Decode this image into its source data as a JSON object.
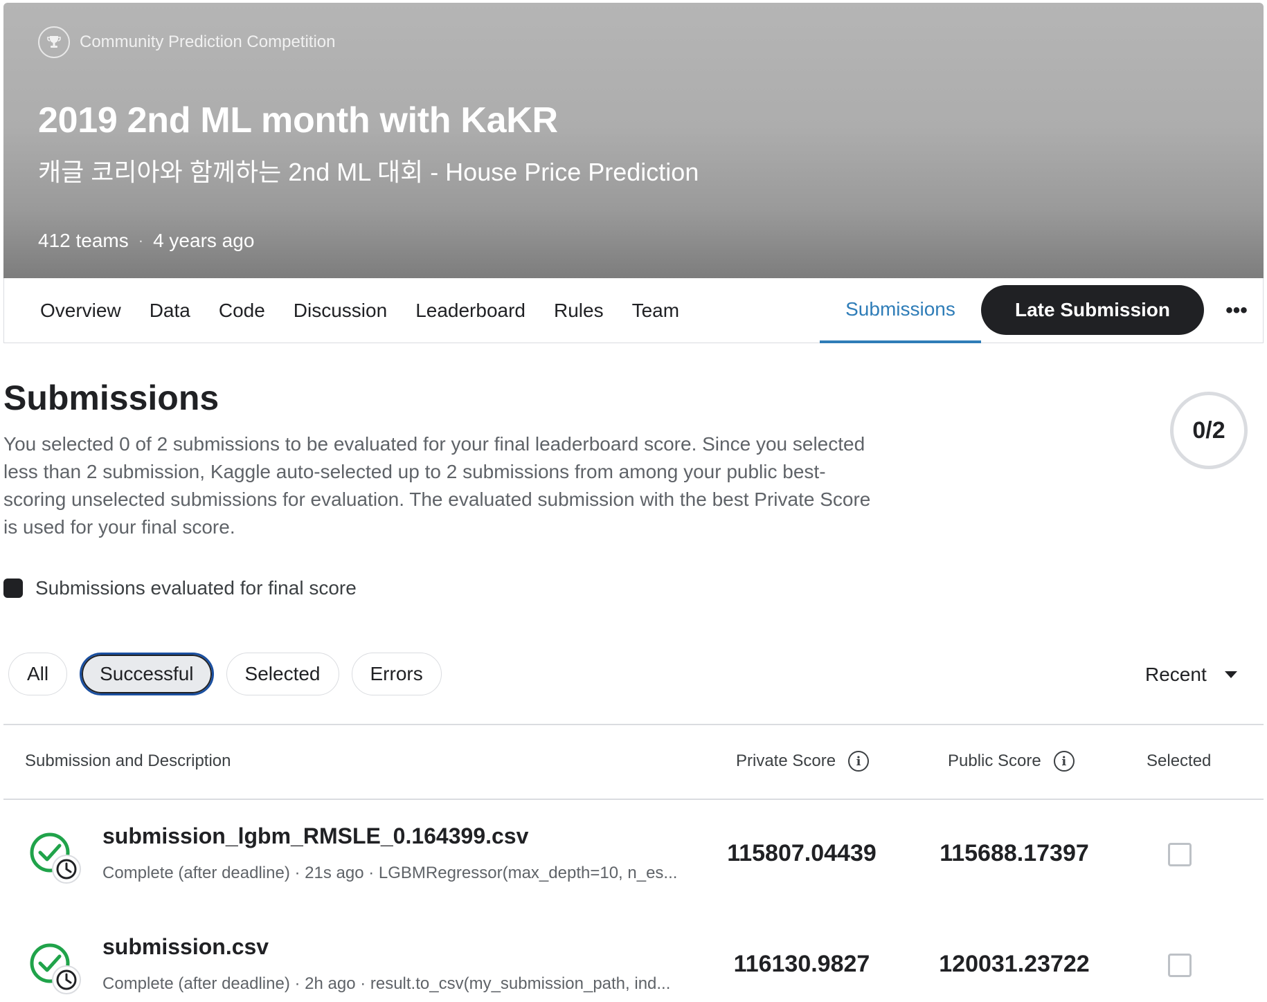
{
  "header": {
    "badge_label": "Community Prediction Competition",
    "badge_icon": "trophy-icon",
    "title": "2019 2nd ML month with KaKR",
    "subtitle": "캐글 코리아와 함께하는 2nd ML 대회 - House Price Prediction",
    "teams": "412 teams",
    "separator": "·",
    "age": "4 years ago"
  },
  "nav": {
    "tabs": [
      "Overview",
      "Data",
      "Code",
      "Discussion",
      "Leaderboard",
      "Rules",
      "Team"
    ],
    "active_tab": "Submissions",
    "late_submission": "Late Submission",
    "more": "•••"
  },
  "submissions": {
    "title": "Submissions",
    "description": "You selected 0 of 2 submissions to be evaluated for your final leaderboard score. Since you selected less than 2 submission, Kaggle auto-selected up to 2 submissions from among your public best-scoring unselected submissions for evaluation. The evaluated submission with the best Private Score is used for your final score.",
    "selected_count": "0/2",
    "legend": "Submissions evaluated for final score"
  },
  "filters": {
    "chips": [
      "All",
      "Successful",
      "Selected",
      "Errors"
    ],
    "active": "Successful",
    "sort": "Recent"
  },
  "table": {
    "headers": {
      "description": "Submission and Description",
      "private": "Private Score",
      "public": "Public Score",
      "selected": "Selected"
    },
    "rows": [
      {
        "name": "submission_lgbm_RMSLE_0.164399.csv",
        "detail": "Complete (after deadline) · 21s ago · LGBMRegressor(max_depth=10, n_es...",
        "private_score": "115807.04439",
        "public_score": "115688.17397",
        "selected": false
      },
      {
        "name": "submission.csv",
        "detail": "Complete (after deadline) · 2h ago · result.to_csv(my_submission_path, ind...",
        "private_score": "116130.9827",
        "public_score": "120031.23722",
        "selected": false
      }
    ]
  },
  "colors": {
    "accent_blue": "#2f7db8",
    "dark": "#202124",
    "success_green": "#20a34a"
  }
}
